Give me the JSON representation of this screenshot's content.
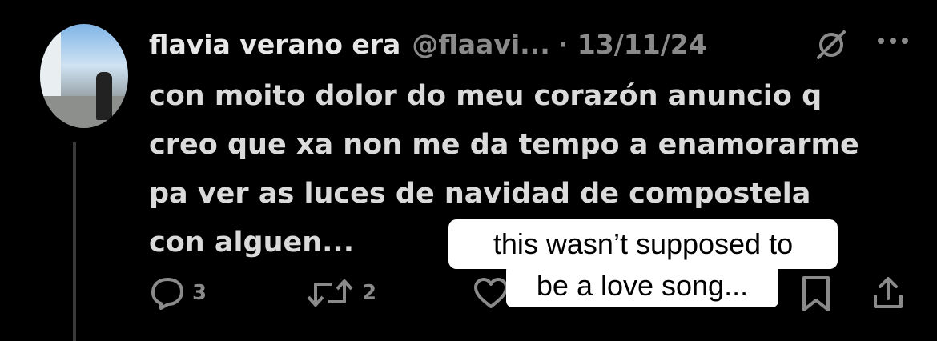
{
  "tweet": {
    "display_name": "flavia verano era",
    "handle": "@flaavi...",
    "date": "· 13/11/24",
    "text": "con moito dolor do meu corazón anuncio q\ncreo que xa non me da tempo a enamorarme\npa ver as luces de navidad de compostela\ncon alguen..."
  },
  "actions": {
    "reply_count": "3",
    "retweet_count": "2"
  },
  "overlay": {
    "caption_line1": "this wasn’t supposed to",
    "caption_line2": "be a love song..."
  },
  "icons": [
    "grok-icon",
    "more-icon",
    "reply-icon",
    "retweet-icon",
    "like-icon",
    "bookmark-icon",
    "share-icon"
  ]
}
